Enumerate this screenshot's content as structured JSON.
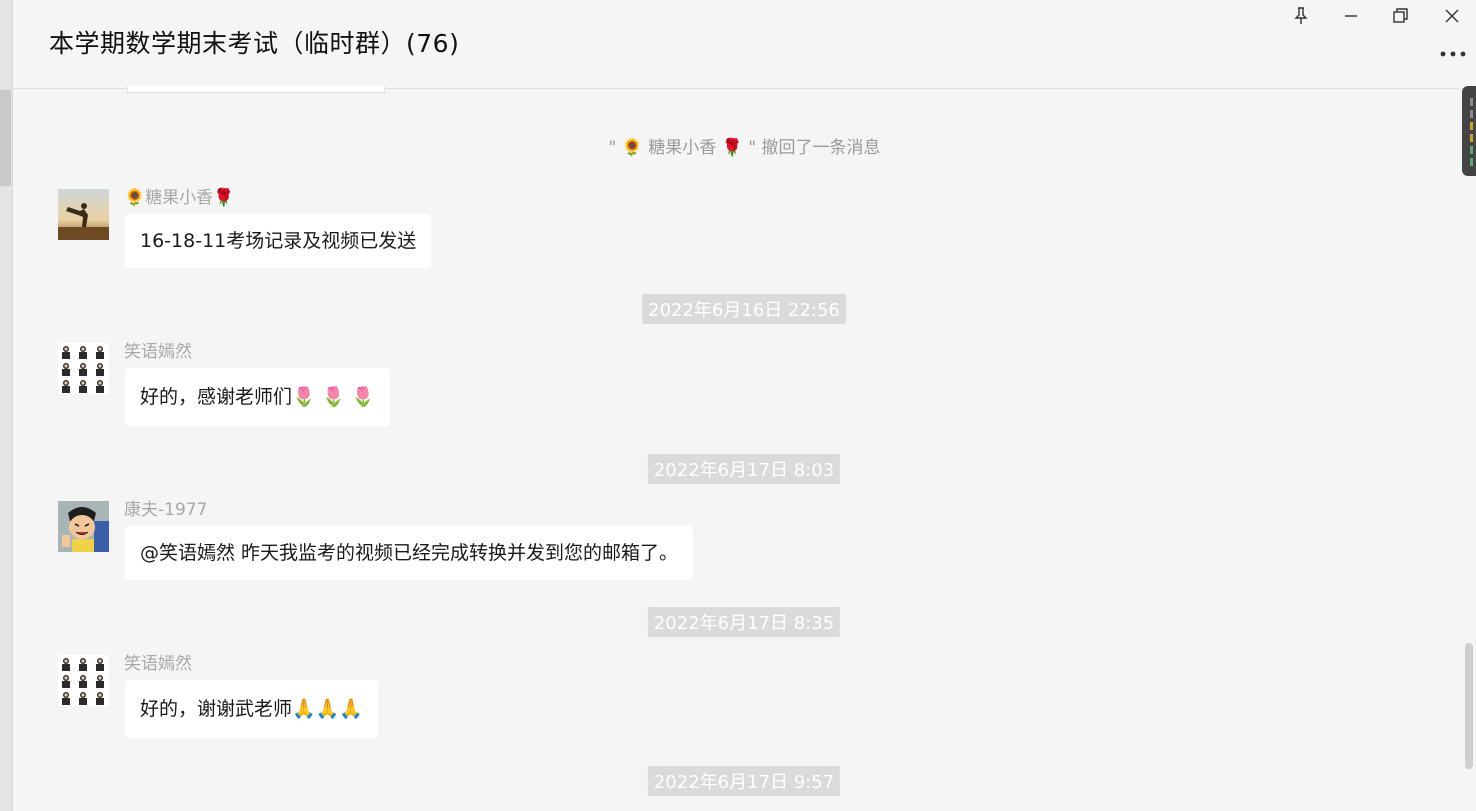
{
  "window": {
    "title": "本学期数学期末考试（临时群）(76)"
  },
  "chat": {
    "system_notice": "\" 🌻 糖果小香 🌹 \" 撤回了一条消息",
    "messages": [
      {
        "sender": "🌻糖果小香🌹",
        "text": "16-18-11考场记录及视频已发送",
        "avatar": "dancer-photo-avatar"
      },
      {
        "timestamp": "2022年6月16日 22:56"
      },
      {
        "sender": "笑语嫣然",
        "text": "好的，感谢老师们🌷 🌷 🌷",
        "avatar": "grid-people-avatar"
      },
      {
        "timestamp": "2022年6月17日 8:03"
      },
      {
        "sender": "康夫-1977",
        "text": "@笑语嫣然  昨天我监考的视频已经完成转换并发到您的邮箱了。",
        "avatar": "cartoon-boy-avatar"
      },
      {
        "timestamp": "2022年6月17日 8:35"
      },
      {
        "sender": "笑语嫣然",
        "text": "好的，谢谢武老师🙏🙏🙏",
        "avatar": "grid-people-avatar"
      },
      {
        "timestamp": "2022年6月17日 9:57"
      }
    ]
  },
  "icons": [
    "pin-icon",
    "minimize-icon",
    "restore-icon",
    "close-icon",
    "more-icon"
  ]
}
